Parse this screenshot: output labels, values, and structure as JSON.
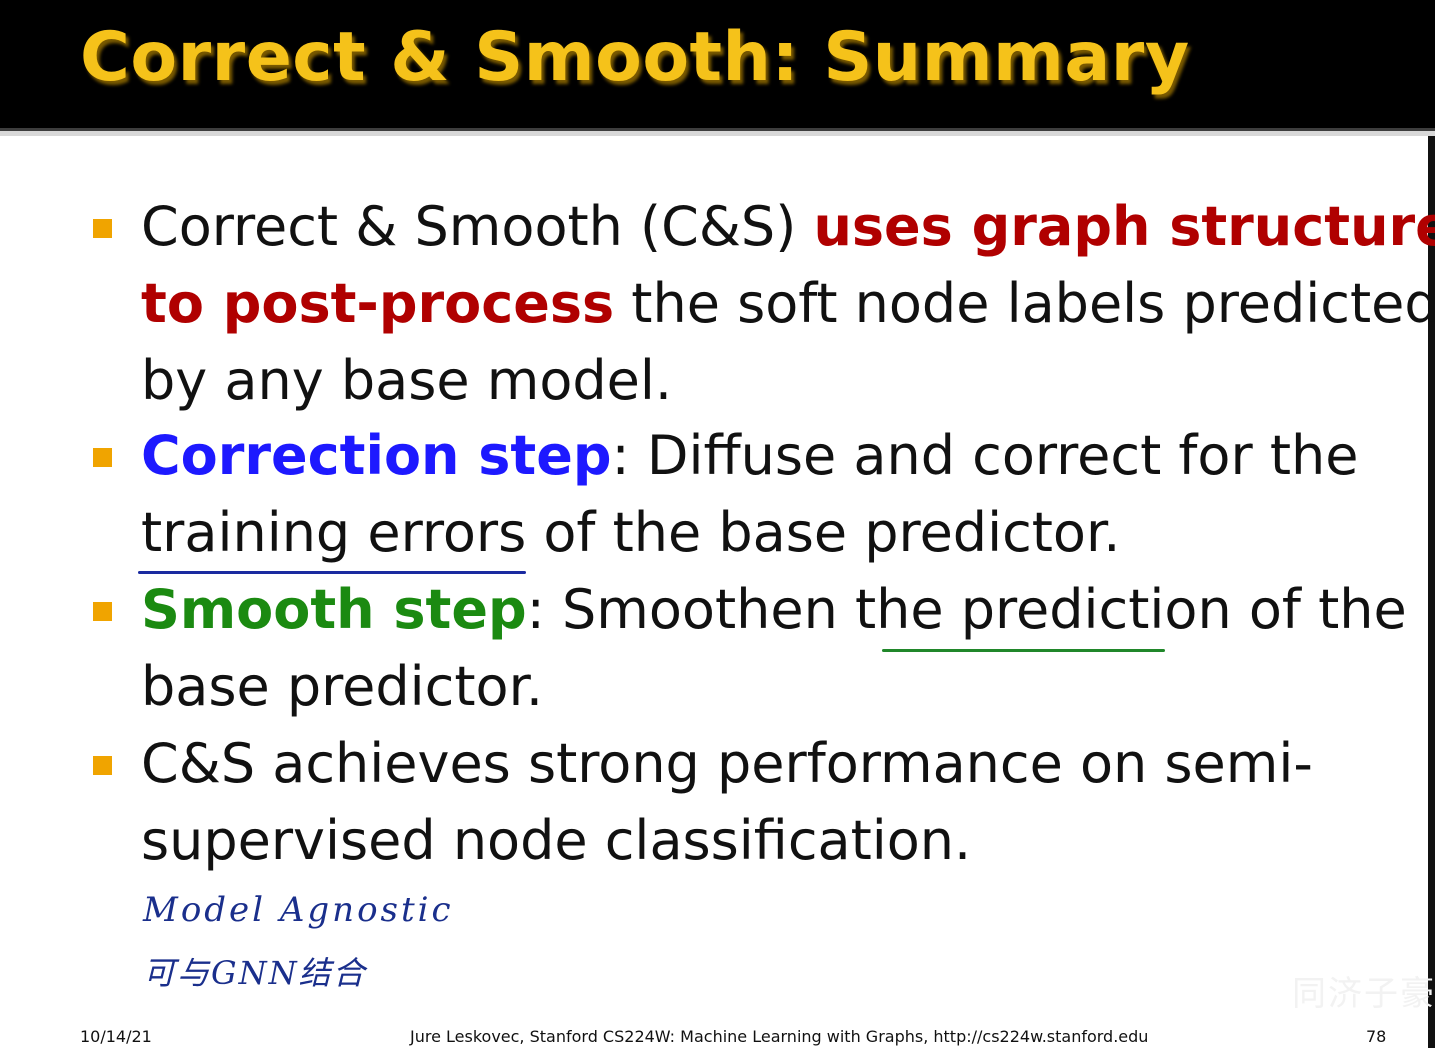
{
  "header": {
    "title": "Correct & Smooth: Summary"
  },
  "bullets": [
    {
      "parts": [
        {
          "text": "Correct & Smooth (C&S) ",
          "style": "normal"
        },
        {
          "text": "uses graph structure",
          "style": "red"
        },
        {
          "br": true
        },
        {
          "text": "to post-process",
          "style": "red"
        },
        {
          "text": " the soft node labels predicted",
          "style": "normal"
        },
        {
          "br": true
        },
        {
          "text": "by any base model.",
          "style": "normal"
        }
      ]
    },
    {
      "parts": [
        {
          "text": "Correction step",
          "style": "blue"
        },
        {
          "text": ": Diffuse and correct for the",
          "style": "normal"
        },
        {
          "br": true
        },
        {
          "text": "training errors of the base predictor.",
          "style": "normal"
        }
      ]
    },
    {
      "parts": [
        {
          "text": "Smooth step",
          "style": "green"
        },
        {
          "text": ": Smoothen the prediction of the",
          "style": "normal"
        },
        {
          "br": true
        },
        {
          "text": "base predictor.",
          "style": "normal"
        }
      ]
    },
    {
      "parts": [
        {
          "text": "C&S achieves strong performance on semi-",
          "style": "normal"
        },
        {
          "br": true
        },
        {
          "text": "supervised node classification.",
          "style": "normal"
        }
      ]
    }
  ],
  "annotations": {
    "line1": "Model Agnostic",
    "line2": "可与GNN结合"
  },
  "footer": {
    "date": "10/14/21",
    "credit": "Jure Leskovec, Stanford CS224W: Machine Learning with Graphs, http://cs224w.stanford.edu",
    "page": "78"
  },
  "watermark": "同济子豪",
  "colors": {
    "title": "#f5c21a",
    "emphasis_red": "#b00000",
    "emphasis_blue": "#1d19ff",
    "emphasis_green": "#1b8a11",
    "bullet_square": "#f0a400",
    "handwriting": "#1a2f8c"
  }
}
